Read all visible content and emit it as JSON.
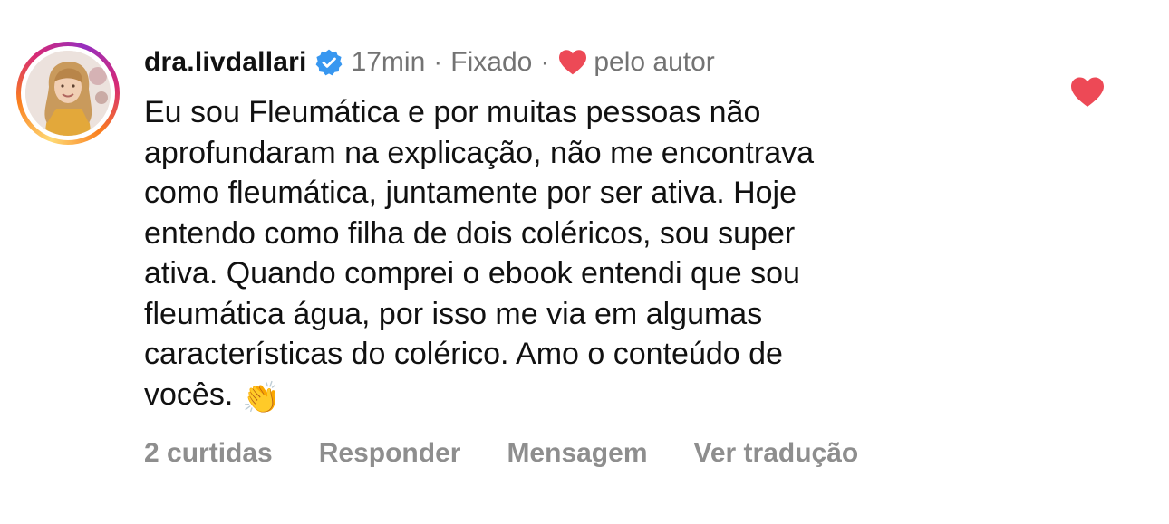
{
  "comment": {
    "username": "dra.livdallari",
    "time": "17min",
    "pinned": "Fixado",
    "liked_by_author": "pelo autor",
    "text": "Eu sou Fleumática e por muitas pessoas não\naprofundaram na explicação, não me encontrava\ncomo fleumática, juntamente por ser ativa. Hoje\nentendo como filha de dois coléricos, sou super\nativa. Quando comprei o ebook entendi que sou\nfleumática água, por isso me via em algumas\ncaracterísticas do colérico. Amo o conteúdo de\nvocês.",
    "emoji": "👏",
    "separator": "·"
  },
  "actions": {
    "likes": "2 curtidas",
    "reply": "Responder",
    "message": "Mensagem",
    "translate": "Ver tradução"
  },
  "icons": {
    "verified": "verified-badge-icon",
    "author_heart": "heart-filled-icon",
    "like": "heart-filled-icon"
  },
  "colors": {
    "verified_blue": "#3897f0",
    "heart_red": "#ed4956",
    "meta_gray": "#737373",
    "action_gray": "#8e8e8e",
    "text": "#111111"
  }
}
